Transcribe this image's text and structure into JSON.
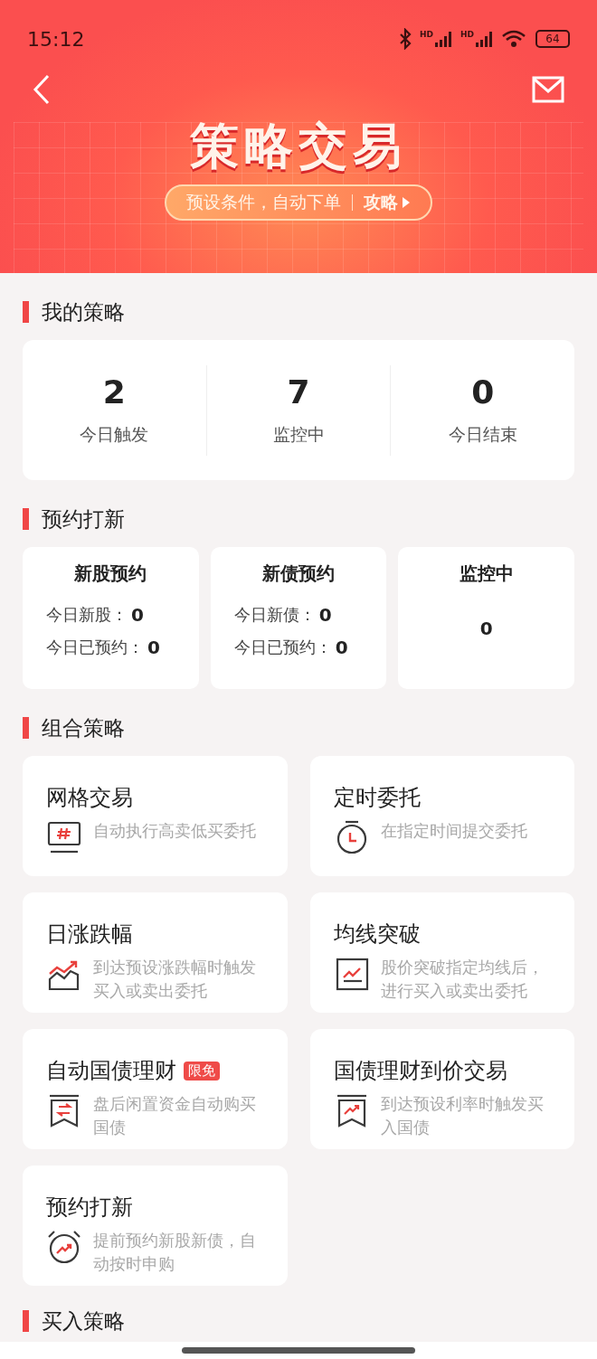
{
  "status_bar": {
    "time": "15:12",
    "signal_labels": [
      "HD",
      "HD"
    ],
    "battery": "64"
  },
  "header": {
    "title": "策略交易",
    "tagline": "预设条件，自动下单",
    "guide_link": "攻略"
  },
  "my_strategies": {
    "heading": "我的策略",
    "stats": [
      {
        "value": "2",
        "label": "今日触发"
      },
      {
        "value": "7",
        "label": "监控中"
      },
      {
        "value": "0",
        "label": "今日结束"
      }
    ]
  },
  "ipo": {
    "heading": "预约打新",
    "cards": [
      {
        "kind": "lines",
        "title": "新股预约",
        "lines": [
          {
            "label": "今日新股：",
            "value": "0"
          },
          {
            "label": "今日已预约：",
            "value": "0"
          }
        ]
      },
      {
        "kind": "lines",
        "title": "新债预约",
        "lines": [
          {
            "label": "今日新债：",
            "value": "0"
          },
          {
            "label": "今日已预约：",
            "value": "0"
          }
        ]
      },
      {
        "kind": "single",
        "title": "监控中",
        "value": "0"
      }
    ]
  },
  "combo": {
    "heading": "组合策略",
    "items": [
      {
        "title": "网格交易",
        "description": "自动执行高卖低买委托"
      },
      {
        "title": "定时委托",
        "description": "在指定时间提交委托"
      },
      {
        "title": "日涨跌幅",
        "description": "到达预设涨跌幅时触发买入或卖出委托"
      },
      {
        "title": "均线突破",
        "description": "股价突破指定均线后，进行买入或卖出委托"
      },
      {
        "title": "自动国债理财",
        "badge": "限免",
        "description": "盘后闲置资金自动购买国债"
      },
      {
        "title": "国债理财到价交易",
        "description": "到达预设利率时触发买入国债"
      },
      {
        "title": "预约打新",
        "description": "提前预约新股新债，自动按时申购"
      }
    ]
  },
  "buy": {
    "heading": "买入策略"
  }
}
